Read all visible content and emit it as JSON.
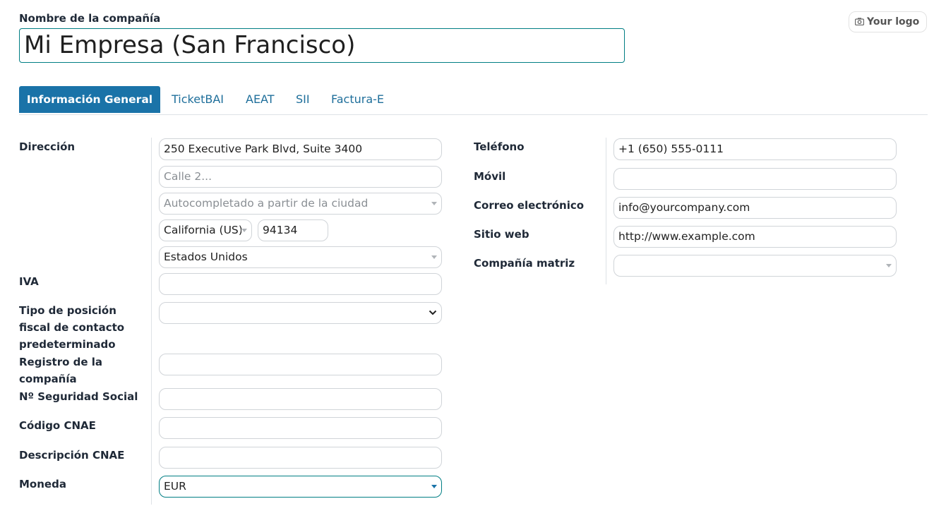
{
  "header": {
    "company_label": "Nombre de la compañía",
    "company_name": "Mi Empresa (San Francisco)",
    "logo_button": "Your logo"
  },
  "tabs": [
    {
      "label": "Información General",
      "active": true
    },
    {
      "label": "TicketBAI"
    },
    {
      "label": "AEAT"
    },
    {
      "label": "SII"
    },
    {
      "label": "Factura-E"
    }
  ],
  "left": {
    "address_label": "Dirección",
    "street": "250 Executive Park Blvd, Suite 3400",
    "street2_placeholder": "Calle 2...",
    "city_placeholder": "Autocompletado a partir de la ciudad",
    "state": "California (US)",
    "zip": "94134",
    "country": "Estados Unidos",
    "vat_label": "IVA",
    "fiscal_position_label": "Tipo de posición fiscal de contacto predeterminado",
    "company_registry_label": "Registro de la compañía",
    "social_security_label": "Nº Seguridad Social",
    "cnae_code_label": "Código CNAE",
    "cnae_description_label": "Descripción CNAE",
    "currency_label": "Moneda",
    "currency": "EUR"
  },
  "right": {
    "phone_label": "Teléfono",
    "phone": "+1 (650) 555-0111",
    "mobile_label": "Móvil",
    "email_label": "Correo electrónico",
    "email": "info@yourcompany.com",
    "website_label": "Sitio web",
    "website": "http://www.example.com",
    "parent_company_label": "Compañía matriz"
  }
}
